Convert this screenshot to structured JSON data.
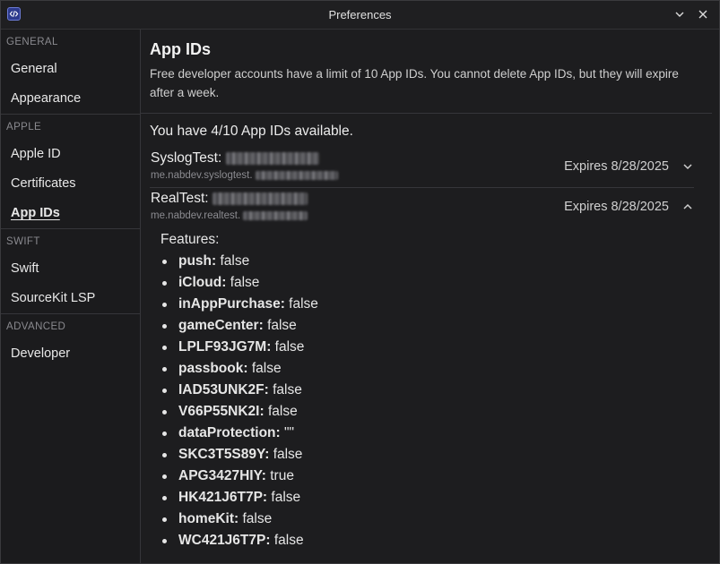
{
  "window": {
    "title": "Preferences"
  },
  "sidebar": {
    "sections": [
      {
        "header": "GENERAL",
        "items": [
          {
            "label": "General"
          },
          {
            "label": "Appearance"
          }
        ]
      },
      {
        "header": "APPLE",
        "items": [
          {
            "label": "Apple ID"
          },
          {
            "label": "Certificates"
          },
          {
            "label": "App IDs"
          }
        ]
      },
      {
        "header": "SWIFT",
        "items": [
          {
            "label": "Swift"
          },
          {
            "label": "SourceKit LSP"
          }
        ]
      },
      {
        "header": "ADVANCED",
        "items": [
          {
            "label": "Developer"
          }
        ]
      }
    ],
    "selected": "App IDs"
  },
  "main": {
    "title": "App IDs",
    "description": "Free developer accounts have a limit of 10 App IDs. You cannot delete App IDs, but they will expire after a week.",
    "availability": "You have 4/10 App IDs available.",
    "app_ids": [
      {
        "name": "SyslogTest:",
        "bundle_prefix": "me.nabdev.syslogtest.",
        "expires": "Expires 8/28/2025",
        "expanded": false
      },
      {
        "name": "RealTest:",
        "bundle_prefix": "me.nabdev.realtest.",
        "expires": "Expires 8/28/2025",
        "expanded": true
      }
    ],
    "features_label": "Features:",
    "features": [
      {
        "key": "push:",
        "value": "false"
      },
      {
        "key": "iCloud:",
        "value": "false"
      },
      {
        "key": "inAppPurchase:",
        "value": "false"
      },
      {
        "key": "gameCenter:",
        "value": "false"
      },
      {
        "key": "LPLF93JG7M:",
        "value": "false"
      },
      {
        "key": "passbook:",
        "value": "false"
      },
      {
        "key": "IAD53UNK2F:",
        "value": "false"
      },
      {
        "key": "V66P55NK2I:",
        "value": "false"
      },
      {
        "key": "dataProtection:",
        "value": "\"\""
      },
      {
        "key": "SKC3T5S89Y:",
        "value": "false"
      },
      {
        "key": "APG3427HIY:",
        "value": "true"
      },
      {
        "key": "HK421J6T7P:",
        "value": "false"
      },
      {
        "key": "homeKit:",
        "value": "false"
      },
      {
        "key": "WC421J6T7P:",
        "value": "false"
      }
    ]
  },
  "colors": {
    "background": "#1d1d1f",
    "border": "#36363a",
    "muted_text": "#8a8a8f",
    "app_icon": "#2d3a8c"
  }
}
